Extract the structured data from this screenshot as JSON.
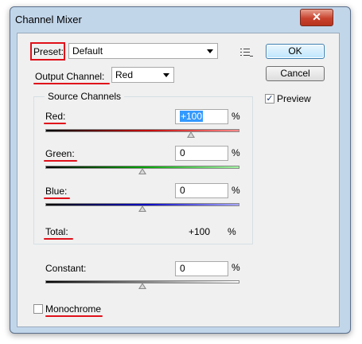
{
  "window": {
    "title": "Channel Mixer",
    "close_glyph": "✕"
  },
  "preset": {
    "label": "Preset:",
    "value": "Default",
    "menu_icon": "list-menu-icon"
  },
  "output_channel": {
    "label": "Output Channel:",
    "value": "Red"
  },
  "buttons": {
    "ok": "OK",
    "cancel": "Cancel"
  },
  "preview": {
    "label": "Preview",
    "checked": true,
    "check_glyph": "✓"
  },
  "source_channels": {
    "title": "Source Channels",
    "channels": [
      {
        "label": "Red:",
        "value": "+100",
        "unit": "%",
        "level_percent": 100,
        "color": "#c00000"
      },
      {
        "label": "Green:",
        "value": "0",
        "unit": "%",
        "level_percent": 0,
        "color": "#00a000"
      },
      {
        "label": "Blue:",
        "value": "0",
        "unit": "%",
        "level_percent": 0,
        "color": "#0000c0"
      }
    ],
    "total": {
      "label": "Total:",
      "value": "+100",
      "unit": "%"
    }
  },
  "constant": {
    "label": "Constant:",
    "value": "0",
    "unit": "%",
    "level_percent": 0
  },
  "monochrome": {
    "label": "Monochrome",
    "checked": false
  },
  "colors": {
    "annotation_red": "#e0101a",
    "window_frame": "#c2d6ea",
    "client_bg": "#f0f0f0"
  }
}
